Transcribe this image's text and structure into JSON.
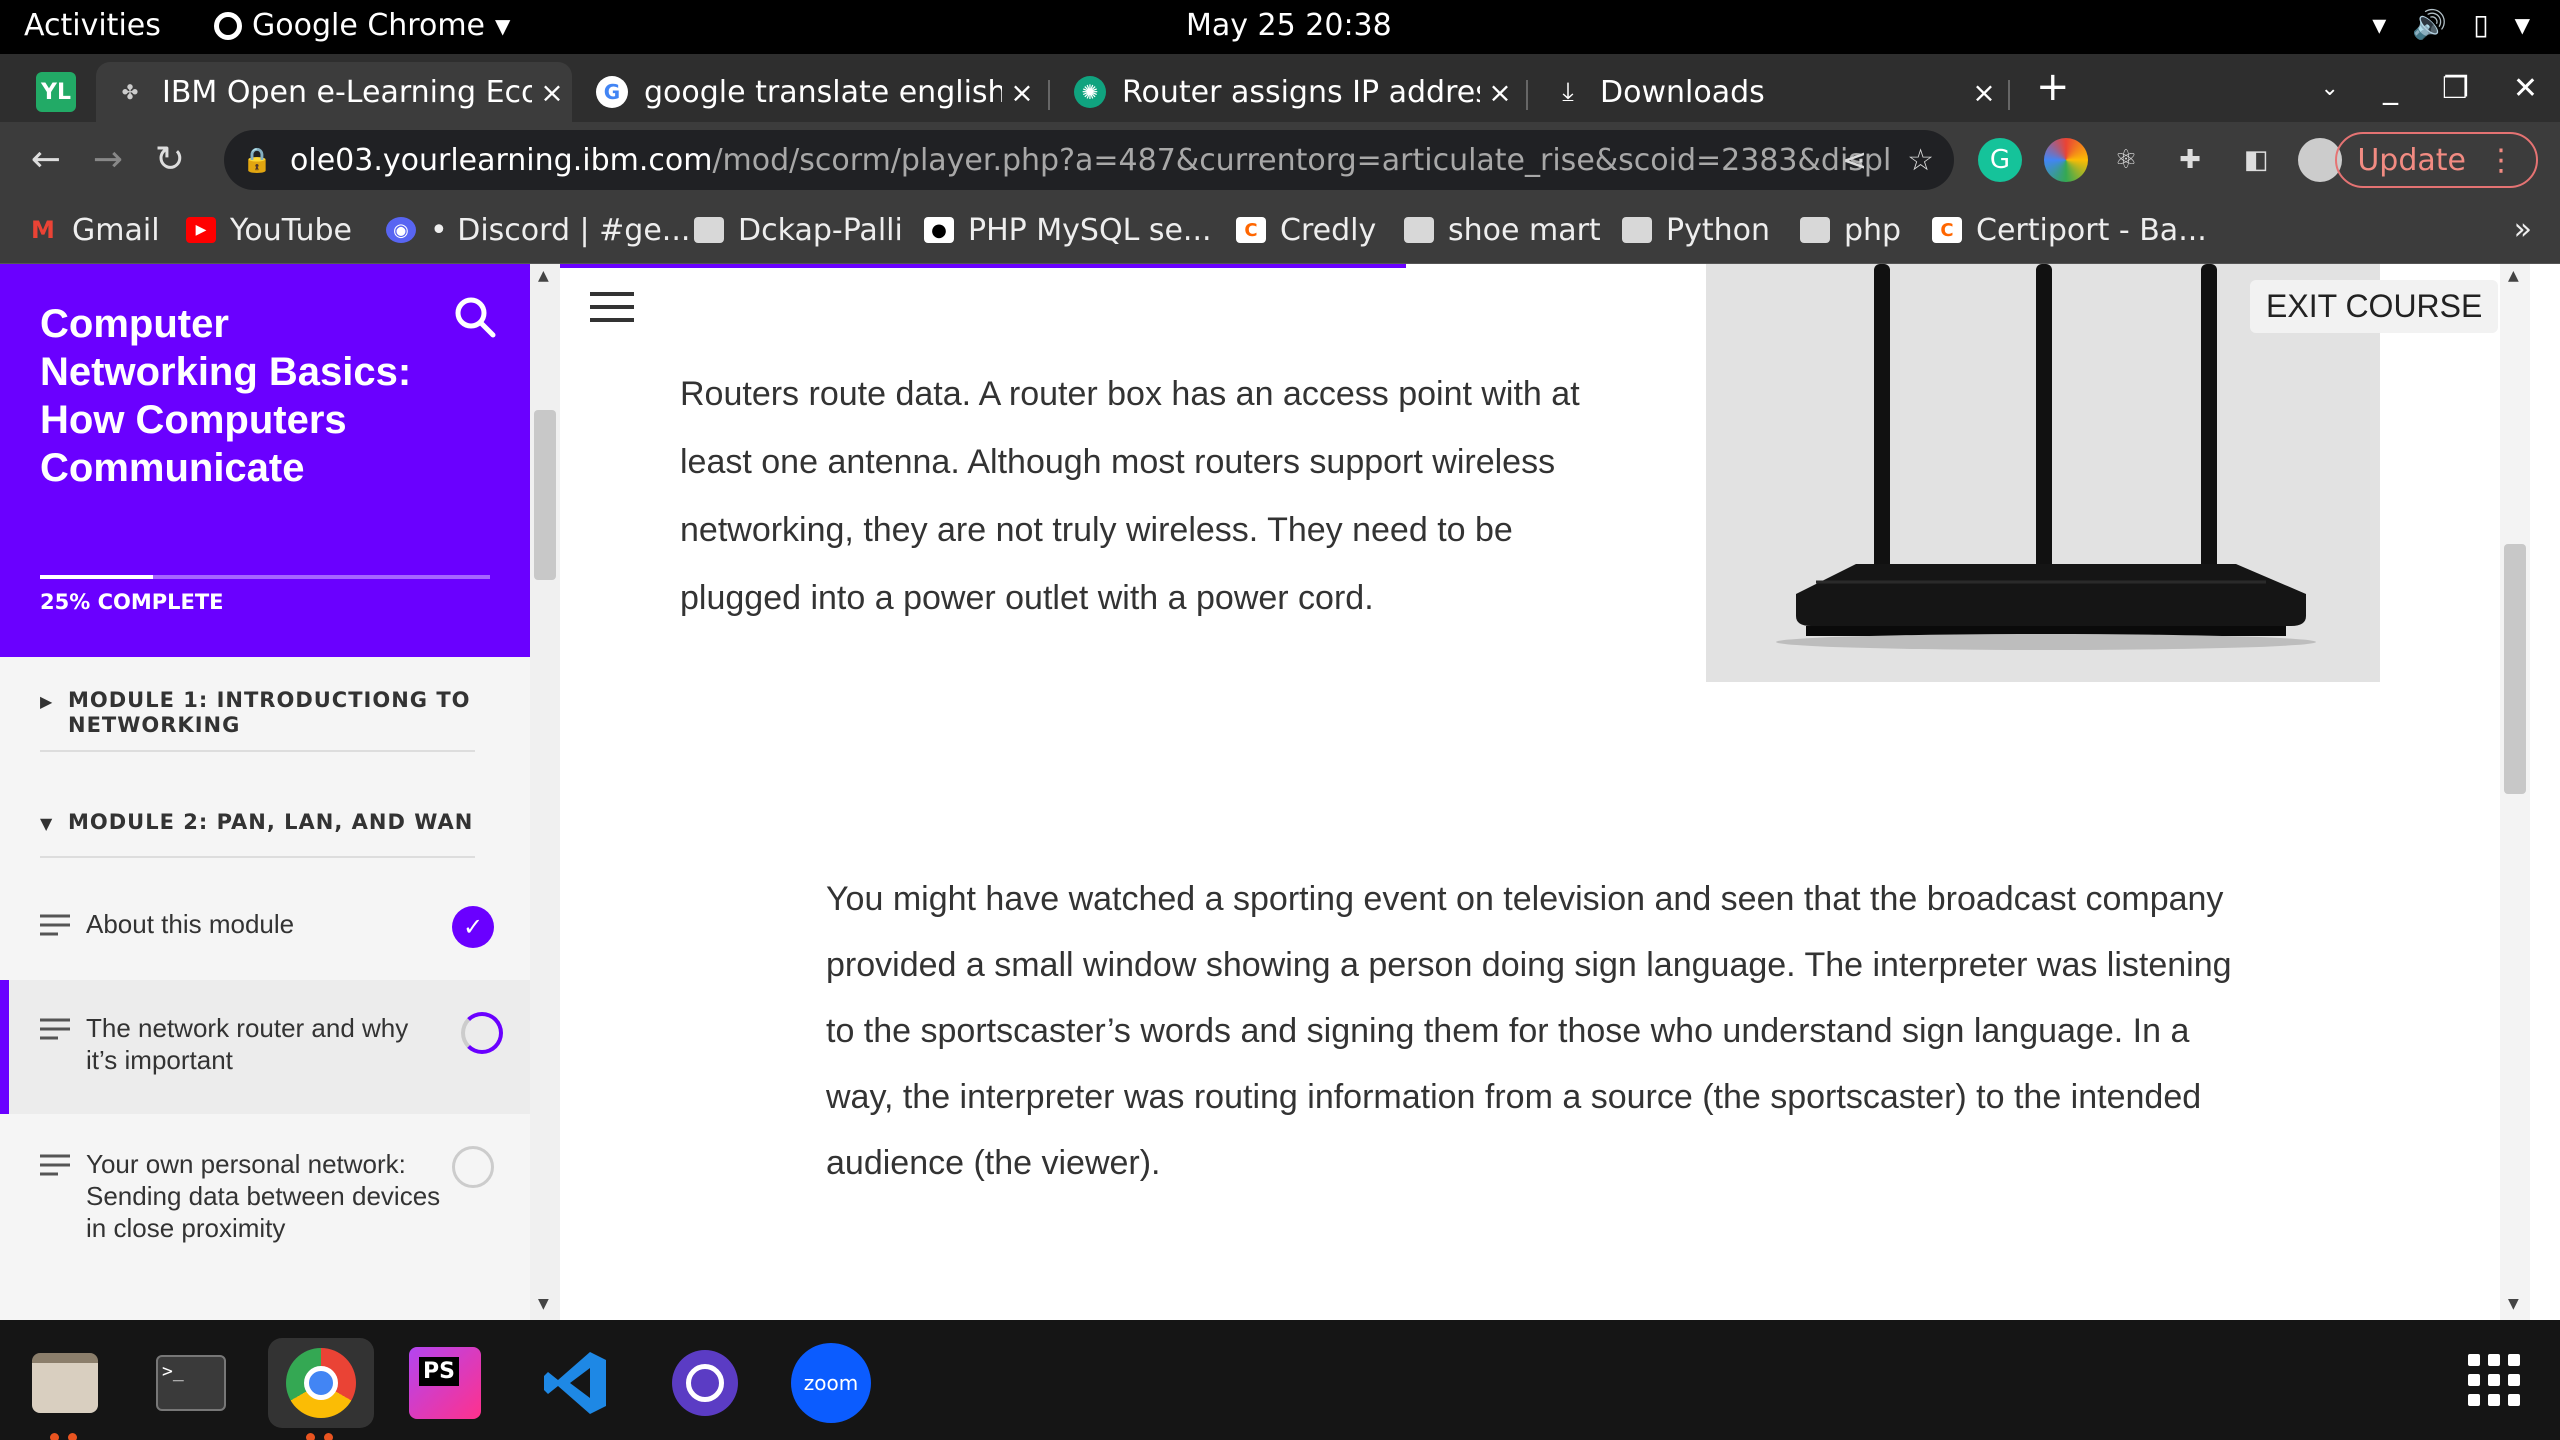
{
  "topbar": {
    "activities": "Activities",
    "app_name": "Google Chrome",
    "clock": "May 25  20:38"
  },
  "tabs": [
    {
      "label": "IBM Open e-Learning Ecos",
      "active": true
    },
    {
      "label": "google translate english t",
      "active": false
    },
    {
      "label": "Router assigns IP address",
      "active": false
    },
    {
      "label": "Downloads",
      "active": false
    }
  ],
  "omnibox": {
    "host": "ole03.yourlearning.ibm.com",
    "path": "/mod/scorm/player.php?a=487&currentorg=articulate_rise&scoid=2383&display=popup&..."
  },
  "update_label": "Update",
  "bookmarks": [
    {
      "label": "Gmail",
      "icon": "gmail-icon"
    },
    {
      "label": "YouTube",
      "icon": "youtube-icon"
    },
    {
      "label": "• Discord | #ge...",
      "icon": "discord-icon"
    },
    {
      "label": "Dckap-Palli",
      "icon": "folder-icon"
    },
    {
      "label": "PHP MySQL se...",
      "icon": "medium-icon"
    },
    {
      "label": "Credly",
      "icon": "credly-icon"
    },
    {
      "label": "shoe mart",
      "icon": "folder-icon"
    },
    {
      "label": "Python",
      "icon": "folder-icon"
    },
    {
      "label": "php",
      "icon": "folder-icon"
    },
    {
      "label": "Certiport - Ba...",
      "icon": "credly-icon"
    }
  ],
  "bookmarks_more": "»",
  "sidebar": {
    "course_title": "Computer Networking Basics: How Computers Communicate",
    "progress_text": "25% COMPLETE",
    "progress_fraction": 0.25,
    "modules": [
      {
        "label": "MODULE 1: INTRODUCTIONG TO NETWORKING",
        "expanded": false
      },
      {
        "label": "MODULE 2: PAN, LAN, AND WAN",
        "expanded": true
      }
    ],
    "lessons": [
      {
        "label": "About this module",
        "status": "done"
      },
      {
        "label": "The network router and why it’s important",
        "status": "partial"
      },
      {
        "label": "Your own personal network: Sending data between devices in close proximity",
        "status": "empty"
      }
    ]
  },
  "main": {
    "exit_label": "EXIT COURSE",
    "para1": "Routers route data. A router box has an access point with at least one antenna. Although most routers support wireless networking, they are not truly wireless. They need to be plugged into a power outlet with a power cord.",
    "para2": "You might have watched a sporting event on television and seen that the broadcast company provided a small window showing a person doing sign language. The interpreter was listening to the sportscaster’s words and signing them for those who understand sign language. In a way, the interpreter was routing information from a source (the sportscaster) to the intended audience (the viewer)."
  },
  "dock": [
    {
      "name": "files-app"
    },
    {
      "name": "terminal-app"
    },
    {
      "name": "chrome-app",
      "running": true
    },
    {
      "name": "phpstorm-app"
    },
    {
      "name": "vscode-app"
    },
    {
      "name": "bitwarden-app"
    },
    {
      "name": "zoom-app",
      "label": "zoom"
    }
  ],
  "colors": {
    "brand": "#6a00ff",
    "chrome_dark": "#3c3c3c",
    "update": "#f28b82"
  }
}
